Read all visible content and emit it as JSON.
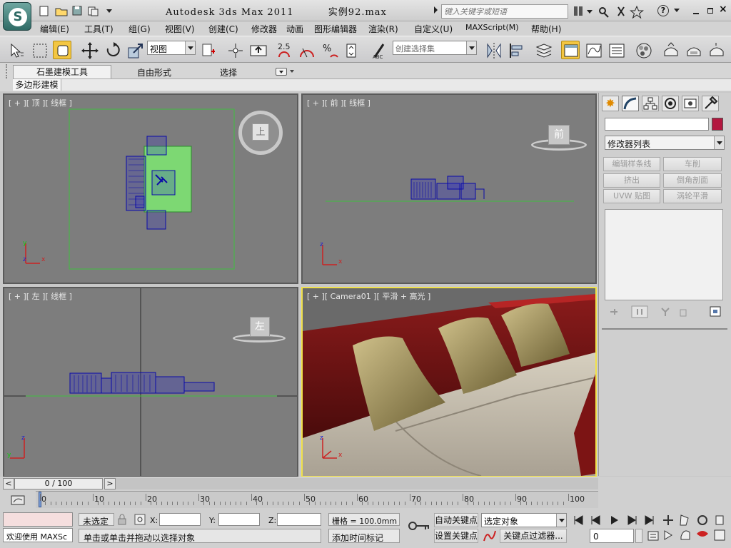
{
  "app": {
    "title": "Autodesk 3ds Max  2011",
    "file": "实例92.max",
    "search_placeholder": "键入关键字或短语"
  },
  "menu": [
    "编辑(E)",
    "工具(T)",
    "组(G)",
    "视图(V)",
    "创建(C)",
    "修改器",
    "动画",
    "图形编辑器",
    "渲染(R)",
    "自定义(U)",
    "MAXScript(M)",
    "帮助(H)"
  ],
  "toolbar": {
    "view_select": "视图",
    "snap_label": "2.5",
    "selection_set": "创建选择集"
  },
  "ribbon": {
    "tabs": [
      "石墨建模工具",
      "自由形式",
      "选择"
    ],
    "subtab": "多边形建模"
  },
  "viewports": {
    "top": {
      "label": "[ + ][ 顶 ][ 线框 ]",
      "cube": "上"
    },
    "front": {
      "label": "[ + ][ 前 ][ 线框 ]",
      "cube": "前"
    },
    "left": {
      "label": "[ + ][ 左 ][ 线框 ]",
      "cube": "左"
    },
    "camera": {
      "label": "[ + ][ Camera01 ][ 平滑 + 高光 ]"
    }
  },
  "command_panel": {
    "modifier_list": "修改器列表",
    "object_color": "#b3173f",
    "buttons": [
      "编辑样条线",
      "车削",
      "挤出",
      "倒角剖面",
      "UVW 贴图",
      "涡轮平滑"
    ]
  },
  "timeline": {
    "frame_label": "0 / 100",
    "ticks": [
      "0",
      "10",
      "20",
      "30",
      "40",
      "50",
      "60",
      "70",
      "80",
      "90",
      "100"
    ]
  },
  "status": {
    "selection": "未选定",
    "x_label": "X:",
    "y_label": "Y:",
    "z_label": "Z:",
    "grid": "栅格 = 100.0mm",
    "prompt": "单击或单击并拖动以选择对象",
    "add_time_tag": "添加时间标记",
    "auto_key": "自动关键点",
    "set_key": "设置关键点",
    "key_target": "选定对象",
    "key_filter": "关键点过滤器...",
    "frame_value": "0",
    "welcome": "欢迎使用 MAXSc"
  }
}
